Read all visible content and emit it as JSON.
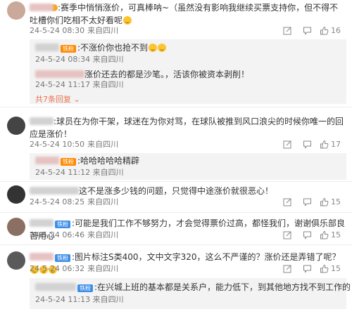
{
  "comments": [
    {
      "text": ":赛季中悄悄涨价，可真棒呐~（虽然没有影响我继续买票支持你，但不得不吐槽你们吃相不太好看呢",
      "time": "24-5-24 08:30",
      "location": "来自四川",
      "likes": "16",
      "replies": [
        {
          "text": ":不涨价你也抢不到",
          "time": "24-5-24 08:34",
          "location": "来自四川"
        },
        {
          "text": "涨价还去的都是沙笔。，活该你被资本剥削！",
          "time": "24-5-24 11:17",
          "location": "来自四川"
        }
      ],
      "more_replies": "共7条回复"
    },
    {
      "text": ":球员在为你干架，球迷在为你对骂，在球队被推到风口浪尖的时候你唯一的回应是涨价！",
      "time": "24-5-24 10:50",
      "location": "来自四川",
      "likes": "17",
      "replies": [
        {
          "text": ":哈哈哈哈哈精辟",
          "time": "24-5-24 11:12",
          "location": "来自四川"
        }
      ]
    },
    {
      "text": "这不是涨多少钱的问题，只觉得中途涨价就很恶心！",
      "time": "24-5-24 08:25",
      "location": "来自四川",
      "likes": "15"
    },
    {
      "text": ":可能是我们工作不够努力，才会觉得票价过高，都怪我们，谢谢俱乐部良苦用心",
      "time": "24-5-24 06:46",
      "location": "来自四川",
      "likes": "15"
    },
    {
      "text": ":图片标注S类400，文中文字320，这么不严谨的？涨价还是弄错了呢？",
      "time": "24-5-24 06:32",
      "location": "来自四川",
      "likes": "15",
      "replies": [
        {
          "text": ":在兴城上班的基本都是关系户，能力低下，到其他地方找不到工作的",
          "time": "24-5-24 11:13",
          "location": "来自四川"
        }
      ]
    }
  ],
  "badge_label": "铁粉",
  "icons": [
    "share-icon",
    "comment-icon",
    "like-icon"
  ],
  "colors": {
    "badge": "#ff8a00",
    "badge_blue": "#3d8ee8",
    "more_link": "#eb7350",
    "meta": "#777777"
  }
}
